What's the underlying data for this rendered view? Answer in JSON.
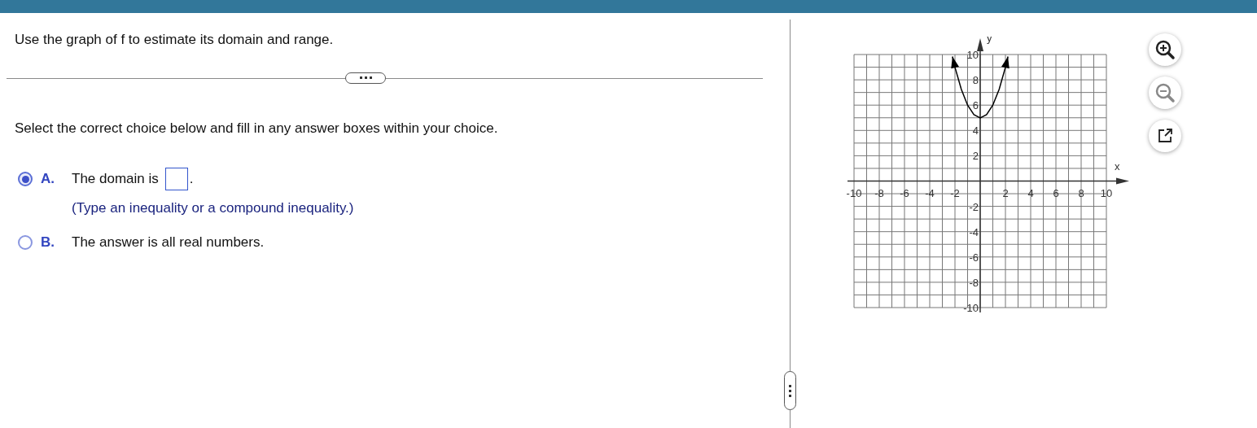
{
  "question": "Use the graph of f to estimate its domain and range.",
  "instruction": "Select the correct choice below and fill in any answer boxes within your choice.",
  "choices": [
    {
      "kind": "answer",
      "letter": "A.",
      "selected": true,
      "text": "The domain is",
      "after": ".",
      "hint": "(Type an inequality or a compound inequality.)"
    },
    {
      "kind": "statement",
      "letter": "B.",
      "selected": false,
      "text": "The answer is all real numbers."
    }
  ],
  "graph": {
    "chart_data": {
      "type": "line",
      "xlabel": "x",
      "ylabel": "y",
      "x": [
        -2.2,
        -2,
        -1.5,
        -1,
        -0.5,
        0,
        0.5,
        1,
        1.5,
        2,
        2.2
      ],
      "grid": true,
      "series": [
        {
          "color": "#000000",
          "values": [
            9.84,
            9,
            7.25,
            6,
            5.25,
            5,
            5.25,
            6,
            7.25,
            9,
            9.84
          ]
        }
      ],
      "xlim": [
        -10,
        10
      ],
      "ylim": [
        -10,
        10
      ],
      "xticks": [
        -10,
        -8,
        -6,
        -4,
        -2,
        2,
        4,
        6,
        8,
        10
      ],
      "yticks": [
        -10,
        -8,
        -6,
        -4,
        -2,
        2,
        4,
        6,
        8,
        10
      ]
    }
  }
}
